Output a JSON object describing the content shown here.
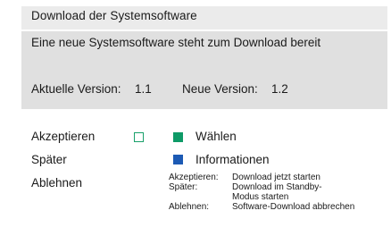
{
  "dialog": {
    "title": "Download der Systemsoftware",
    "message": "Eine neue Systemsoftware steht zum Download bereit",
    "current_version_label": "Aktuelle Version:",
    "current_version_value": "1.1",
    "new_version_label": "Neue Version:",
    "new_version_value": "1.2"
  },
  "menu": {
    "items": [
      {
        "label": "Akzeptieren"
      },
      {
        "label": "Später"
      },
      {
        "label": "Ablehnen"
      }
    ]
  },
  "keys": {
    "select_label": "Wählen",
    "info_label": "Informationen",
    "colors": {
      "outline": "#19a06a",
      "green": "#0e9a67",
      "blue": "#1c5ab4"
    }
  },
  "help": {
    "rows": [
      {
        "key": "Akzeptieren:",
        "text": "Download jetzt starten"
      },
      {
        "key": "Später:",
        "text": "Download im Standby-Modus starten"
      },
      {
        "key": "Ablehnen:",
        "text": "Software-Download abbrechen"
      }
    ]
  }
}
